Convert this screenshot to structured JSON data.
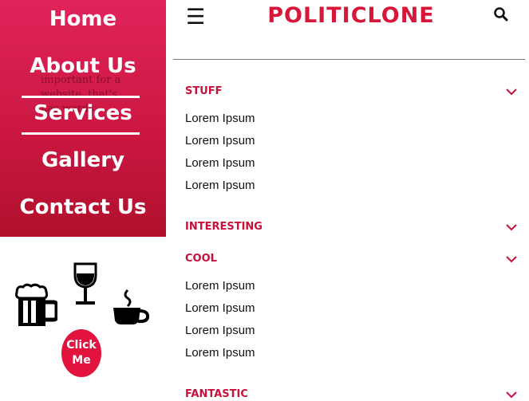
{
  "drawer": {
    "background_snippet": "important for a website, that's has words",
    "menu": [
      {
        "label": "Home"
      },
      {
        "label": "About Us"
      },
      {
        "label": "Services"
      },
      {
        "label": "Gallery"
      },
      {
        "label": "Contact Us"
      }
    ],
    "icons": [
      "beer-mug-icon",
      "wine-glass-icon",
      "coffee-cup-icon"
    ],
    "click_button": {
      "line1": "Click",
      "line2": "Me"
    },
    "accent": "#d6173a"
  },
  "header": {
    "menu_icon": "☰",
    "brand": "POLITICLONE",
    "search_icon": "search-icon"
  },
  "sections": [
    {
      "title": "STUFF",
      "items": [
        "Lorem Ipsum",
        "Lorem Ipsum",
        "Lorem Ipsum",
        "Lorem Ipsum"
      ]
    },
    {
      "title": "INTERESTING",
      "items": []
    },
    {
      "title": "COOL",
      "items": [
        "Lorem Ipsum",
        "Lorem Ipsum",
        "Lorem Ipsum",
        "Lorem Ipsum"
      ]
    },
    {
      "title": "FANTASTIC",
      "items": []
    }
  ],
  "colors": {
    "section_title": "#c8103a",
    "brand": "#d6173a",
    "drawer": "#cc1742"
  }
}
